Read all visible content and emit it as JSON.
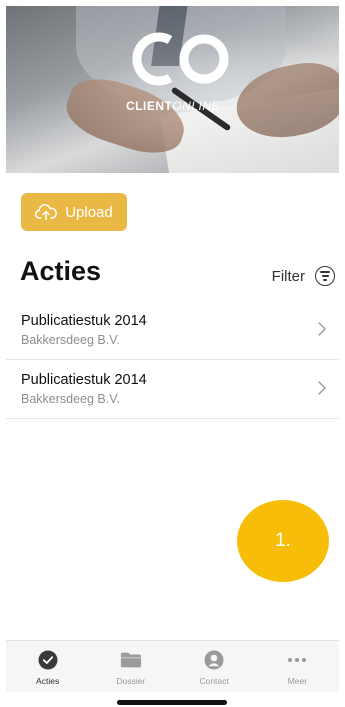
{
  "hero": {
    "logo_mark": "CO",
    "logo_text_bold": "CLIENT",
    "logo_text_light": "ONLINE"
  },
  "upload": {
    "label": "Upload",
    "icon": "cloud-upload-icon",
    "color": "#eab845"
  },
  "actions": {
    "heading": "Acties",
    "filter_label": "Filter",
    "items": [
      {
        "title": "Publicatiestuk 2014",
        "subtitle": "Bakkersdeeg B.V."
      },
      {
        "title": "Publicatiestuk 2014",
        "subtitle": "Bakkersdeeg B.V."
      }
    ]
  },
  "marker": {
    "label": "1.",
    "color": "#f8bd09"
  },
  "tabbar": {
    "active": "Acties",
    "tabs": [
      {
        "label": "Acties",
        "icon": "check-circle-icon"
      },
      {
        "label": "Dossier",
        "icon": "folder-icon"
      },
      {
        "label": "Contact",
        "icon": "person-circle-icon"
      },
      {
        "label": "Meer",
        "icon": "more-dots-icon"
      }
    ]
  }
}
